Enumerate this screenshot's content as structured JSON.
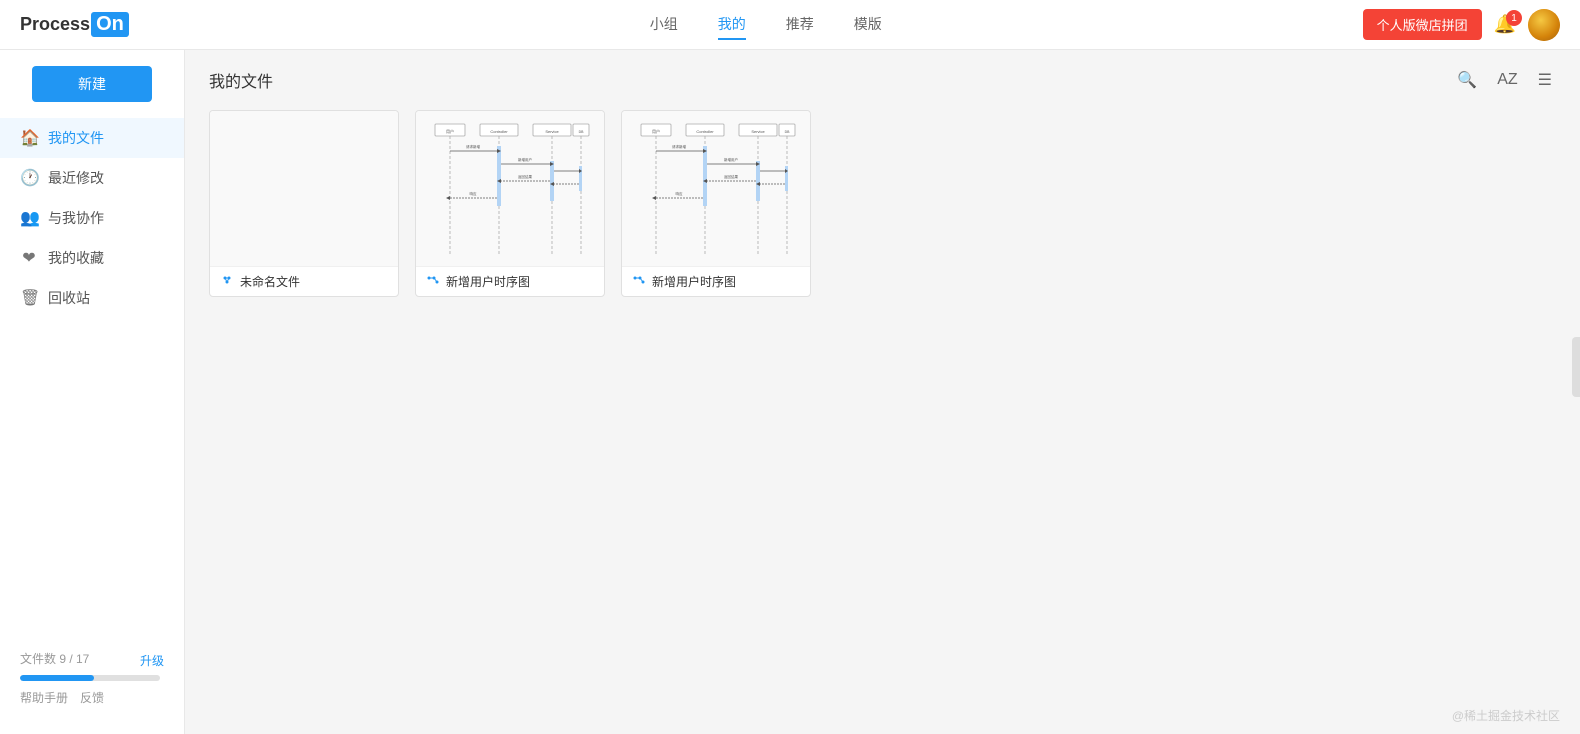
{
  "header": {
    "logo_text": "ProcessOn",
    "logo_process": "Process",
    "logo_on": "On",
    "nav": [
      {
        "label": "小组",
        "active": false
      },
      {
        "label": "我的",
        "active": true
      },
      {
        "label": "推荐",
        "active": false
      },
      {
        "label": "模版",
        "active": false
      }
    ],
    "vip_button": "个人版微店拼团",
    "notification_count": "1"
  },
  "sidebar": {
    "new_button": "新建",
    "items": [
      {
        "label": "我的文件",
        "icon": "🏠",
        "active": true
      },
      {
        "label": "最近修改",
        "icon": "🕐",
        "active": false
      },
      {
        "label": "与我协作",
        "icon": "👥",
        "active": false
      },
      {
        "label": "我的收藏",
        "icon": "❤",
        "active": false
      },
      {
        "label": "回收站",
        "icon": "🗑",
        "active": false
      }
    ],
    "file_count": "文件数 9 / 17",
    "upgrade": "升级",
    "progress_percent": 53,
    "help": "帮助手册",
    "feedback": "反馈"
  },
  "content": {
    "title": "我的文件",
    "files": [
      {
        "name": "未命名文件",
        "has_thumbnail": false
      },
      {
        "name": "新增用户时序图",
        "has_thumbnail": true
      },
      {
        "name": "新增用户时序图",
        "has_thumbnail": true
      }
    ]
  },
  "footer": {
    "watermark": "@稀土掘金技术社区"
  }
}
